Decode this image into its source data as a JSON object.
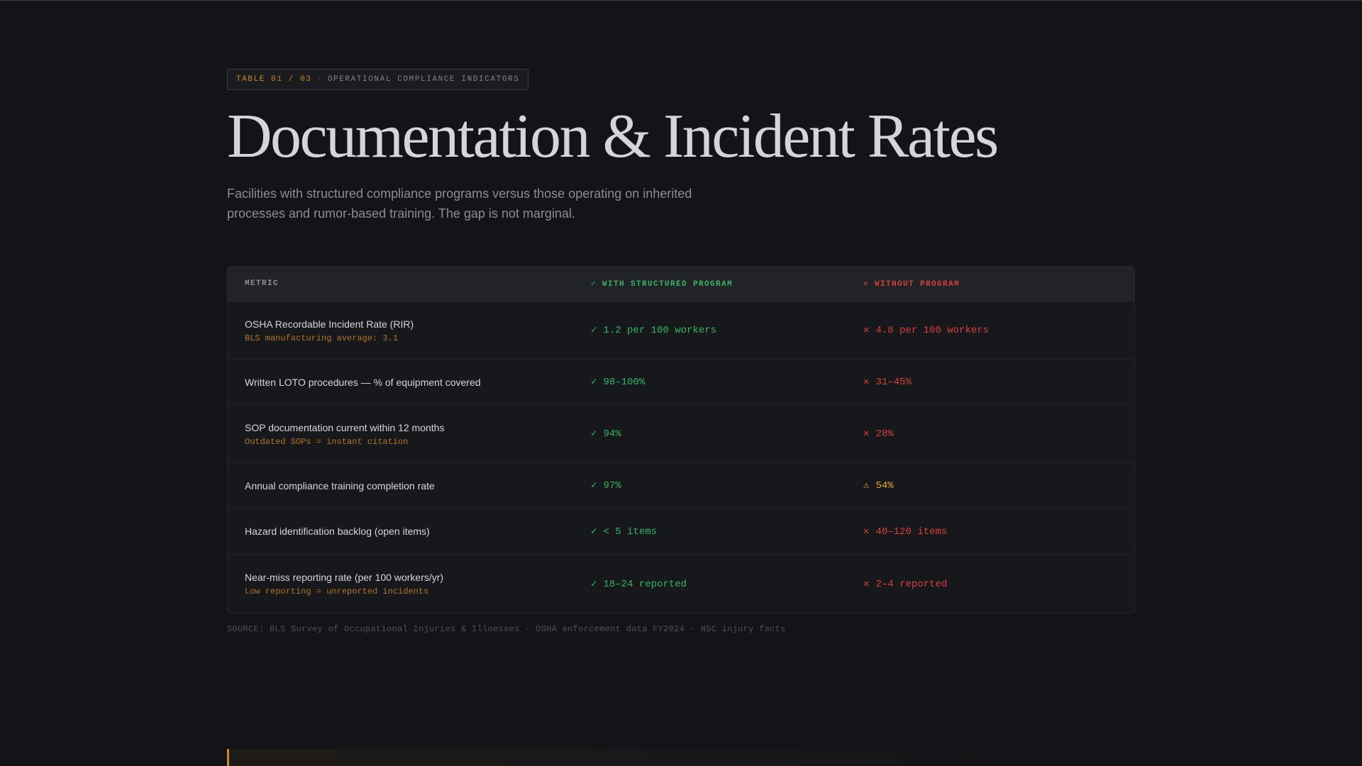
{
  "tag": {
    "id": "TABLE 01 / 03",
    "separator": "·",
    "label": "OPERATIONAL COMPLIANCE INDICATORS"
  },
  "title": "Documentation & Incident Rates",
  "subtitle": "Facilities with structured compliance programs versus those operating on inherited processes and rumor-based training. The gap is not marginal.",
  "table": {
    "headers": {
      "metric": "METRIC",
      "with": "✓ WITH STRUCTURED PROGRAM",
      "without": "✕ WITHOUT PROGRAM"
    },
    "rows": [
      {
        "metric": "OSHA Recordable Incident Rate (RIR)",
        "note": "BLS manufacturing average: 3.1",
        "with": {
          "icon": "✓",
          "status": "good",
          "value": "1.2 per 100 workers"
        },
        "without": {
          "icon": "✕",
          "status": "bad",
          "value": "4.8 per 100 workers"
        }
      },
      {
        "metric": "Written LOTO procedures — % of equipment covered",
        "note": "",
        "with": {
          "icon": "✓",
          "status": "good",
          "value": "98–100%"
        },
        "without": {
          "icon": "✕",
          "status": "bad",
          "value": "31–45%"
        }
      },
      {
        "metric": "SOP documentation current within 12 months",
        "note": "Outdated SOPs = instant citation",
        "with": {
          "icon": "✓",
          "status": "good",
          "value": "94%"
        },
        "without": {
          "icon": "✕",
          "status": "bad",
          "value": "28%"
        }
      },
      {
        "metric": "Annual compliance training completion rate",
        "note": "",
        "with": {
          "icon": "✓",
          "status": "good",
          "value": "97%"
        },
        "without": {
          "icon": "⚠",
          "status": "warn",
          "value": "54%"
        }
      },
      {
        "metric": "Hazard identification backlog (open items)",
        "note": "",
        "with": {
          "icon": "✓",
          "status": "good",
          "value": "< 5 items"
        },
        "without": {
          "icon": "✕",
          "status": "bad",
          "value": "40–120 items"
        }
      },
      {
        "metric": "Near-miss reporting rate (per 100 workers/yr)",
        "note": "Low reporting = unreported incidents",
        "with": {
          "icon": "✓",
          "status": "good",
          "value": "18–24 reported"
        },
        "without": {
          "icon": "✕",
          "status": "bad",
          "value": "2–4 reported"
        }
      }
    ]
  },
  "source": "SOURCE: BLS Survey of Occupational Injuries & Illnesses · OSHA enforcement data FY2024 · NSC injury facts",
  "colors": {
    "background": "#131417",
    "good": "#35b464",
    "bad": "#d9403a",
    "warn": "#e6a534",
    "accent": "#c98a2e"
  }
}
